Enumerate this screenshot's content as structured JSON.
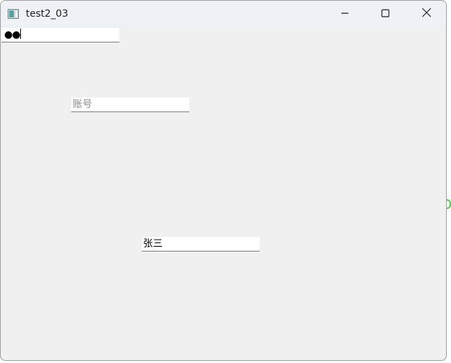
{
  "window": {
    "title": "test2_03",
    "icon": "app-window-icon",
    "controls": {
      "minimize_icon": "minimize-icon",
      "maximize_icon": "maximize-icon",
      "close_icon": "close-icon"
    }
  },
  "form": {
    "password": {
      "masked_value": "●●"
    },
    "account": {
      "value": "",
      "placeholder": "账号"
    },
    "name": {
      "value": "张三"
    }
  },
  "colors": {
    "window_bg": "#f0f0f0",
    "titlebar_bg": "#eff1f6",
    "field_bg": "#ffffff",
    "placeholder": "#8a8a8a",
    "edge_mark": "#4ccc4c"
  }
}
